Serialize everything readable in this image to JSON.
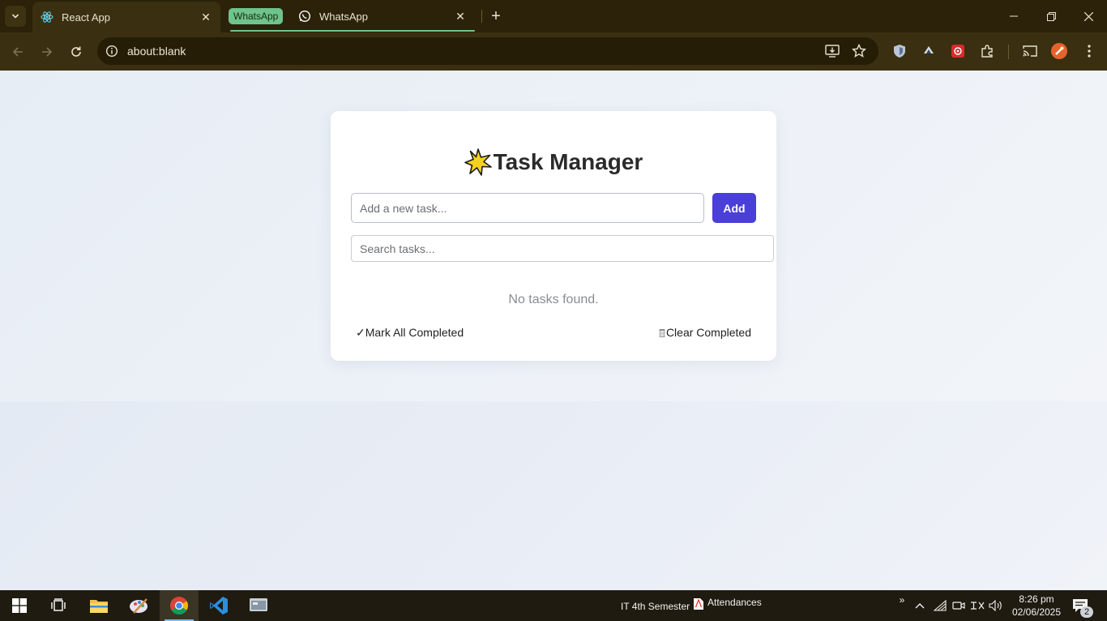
{
  "browser": {
    "tabs": [
      {
        "title": "React App",
        "active": true,
        "icon": "react-icon"
      },
      {
        "title": "WhatsApp",
        "active": false,
        "icon": "whatsapp-icon"
      }
    ],
    "tab_group_label": "WhatsApp",
    "tab_group_color": "#6fc38c",
    "url": "about:blank"
  },
  "app": {
    "title": "Task Manager",
    "title_icon": "star-emoji",
    "new_task_placeholder": "Add a new task...",
    "add_button": "Add",
    "search_placeholder": "Search tasks...",
    "empty_message": "No tasks found.",
    "mark_all_label": "✓Mark All Completed",
    "clear_completed_label": "Clear Completed",
    "accent_color": "#4a3fd8"
  },
  "taskbar": {
    "items": [
      {
        "name": "start",
        "icon": "windows-icon"
      },
      {
        "name": "task-view",
        "icon": "task-view-icon"
      },
      {
        "name": "file-explorer",
        "icon": "folder-icon"
      },
      {
        "name": "snipping-tool",
        "icon": "paint-icon"
      },
      {
        "name": "chrome",
        "icon": "chrome-icon",
        "active": true
      },
      {
        "name": "vscode",
        "icon": "vscode-icon"
      },
      {
        "name": "app",
        "icon": "app-window-icon"
      }
    ],
    "toolbar_label": "IT 4th Semester",
    "pinned_doc": "Attendances",
    "time": "8:26 pm",
    "date": "02/06/2025",
    "notification_count": "2"
  }
}
